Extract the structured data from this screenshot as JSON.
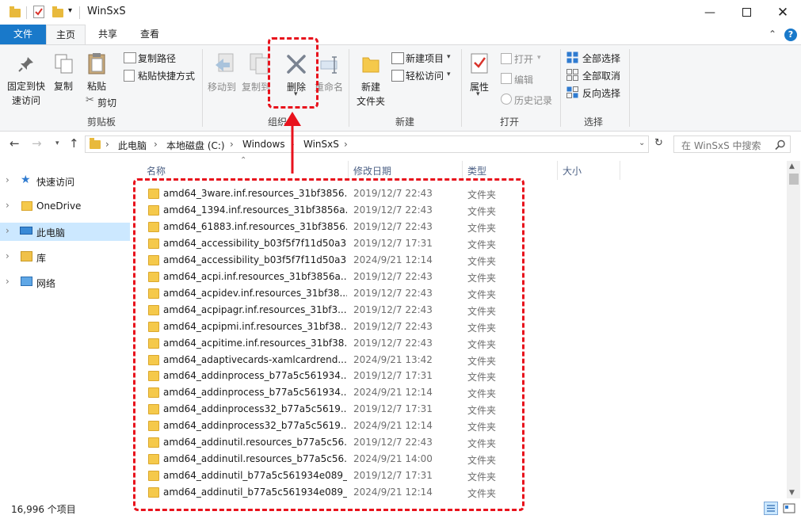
{
  "window": {
    "title": "WinSxS"
  },
  "tabs": [
    {
      "label": "文件"
    },
    {
      "label": "主页"
    },
    {
      "label": "共享"
    },
    {
      "label": "查看"
    }
  ],
  "ribbon": {
    "clipboard": {
      "pin_line1": "固定到快",
      "pin_line2": "速访问",
      "copy": "复制",
      "paste": "粘贴",
      "copy_path": "复制路径",
      "paste_shortcut": "粘贴快捷方式",
      "cut": "剪切",
      "group": "剪贴板"
    },
    "organize": {
      "move_to": "移动到",
      "copy_to": "复制到",
      "delete": "删除",
      "rename": "重命名",
      "group": "组织"
    },
    "new": {
      "new_folder_line1": "新建",
      "new_folder_line2": "文件夹",
      "new_item": "新建项目",
      "easy_access": "轻松访问",
      "group": "新建"
    },
    "open": {
      "properties": "属性",
      "open": "打开",
      "edit": "编辑",
      "history": "历史记录",
      "group": "打开"
    },
    "select": {
      "select_all": "全部选择",
      "select_none": "全部取消",
      "invert": "反向选择",
      "group": "选择"
    }
  },
  "address": {
    "crumbs": [
      "此电脑",
      "本地磁盘 (C:)",
      "Windows",
      "WinSxS"
    ],
    "search_placeholder": "在 WinSxS 中搜索"
  },
  "nav": [
    {
      "label": "快速访问"
    },
    {
      "label": "OneDrive"
    },
    {
      "label": "此电脑"
    },
    {
      "label": "库"
    },
    {
      "label": "网络"
    }
  ],
  "columns": {
    "name": "名称",
    "date": "修改日期",
    "type": "类型",
    "size": "大小"
  },
  "files": [
    {
      "name": "amd64_3ware.inf.resources_31bf3856...",
      "date": "2019/12/7 22:43",
      "type": "文件夹"
    },
    {
      "name": "amd64_1394.inf.resources_31bf3856a...",
      "date": "2019/12/7 22:43",
      "type": "文件夹"
    },
    {
      "name": "amd64_61883.inf.resources_31bf3856...",
      "date": "2019/12/7 22:43",
      "type": "文件夹"
    },
    {
      "name": "amd64_accessibility_b03f5f7f11d50a3...",
      "date": "2019/12/7 17:31",
      "type": "文件夹"
    },
    {
      "name": "amd64_accessibility_b03f5f7f11d50a3...",
      "date": "2024/9/21 12:14",
      "type": "文件夹"
    },
    {
      "name": "amd64_acpi.inf.resources_31bf3856a...",
      "date": "2019/12/7 22:43",
      "type": "文件夹"
    },
    {
      "name": "amd64_acpidev.inf.resources_31bf38...",
      "date": "2019/12/7 22:43",
      "type": "文件夹"
    },
    {
      "name": "amd64_acpipagr.inf.resources_31bf3...",
      "date": "2019/12/7 22:43",
      "type": "文件夹"
    },
    {
      "name": "amd64_acpipmi.inf.resources_31bf38...",
      "date": "2019/12/7 22:43",
      "type": "文件夹"
    },
    {
      "name": "amd64_acpitime.inf.resources_31bf38...",
      "date": "2019/12/7 22:43",
      "type": "文件夹"
    },
    {
      "name": "amd64_adaptivecards-xamlcardrend...",
      "date": "2024/9/21 13:42",
      "type": "文件夹"
    },
    {
      "name": "amd64_addinprocess_b77a5c561934...",
      "date": "2019/12/7 17:31",
      "type": "文件夹"
    },
    {
      "name": "amd64_addinprocess_b77a5c561934...",
      "date": "2024/9/21 12:14",
      "type": "文件夹"
    },
    {
      "name": "amd64_addinprocess32_b77a5c5619...",
      "date": "2019/12/7 17:31",
      "type": "文件夹"
    },
    {
      "name": "amd64_addinprocess32_b77a5c5619...",
      "date": "2024/9/21 12:14",
      "type": "文件夹"
    },
    {
      "name": "amd64_addinutil.resources_b77a5c56...",
      "date": "2019/12/7 22:43",
      "type": "文件夹"
    },
    {
      "name": "amd64_addinutil.resources_b77a5c56...",
      "date": "2024/9/21 14:00",
      "type": "文件夹"
    },
    {
      "name": "amd64_addinutil_b77a5c561934e089_...",
      "date": "2019/12/7 17:31",
      "type": "文件夹"
    },
    {
      "name": "amd64_addinutil_b77a5c561934e089_...",
      "date": "2024/9/21 12:14",
      "type": "文件夹"
    }
  ],
  "status": {
    "count": "16,996 个项目"
  },
  "colors": {
    "accent": "#1979ca",
    "highlight": "#e8121c",
    "selection": "#cce8ff",
    "folder": "#f5c94b"
  }
}
